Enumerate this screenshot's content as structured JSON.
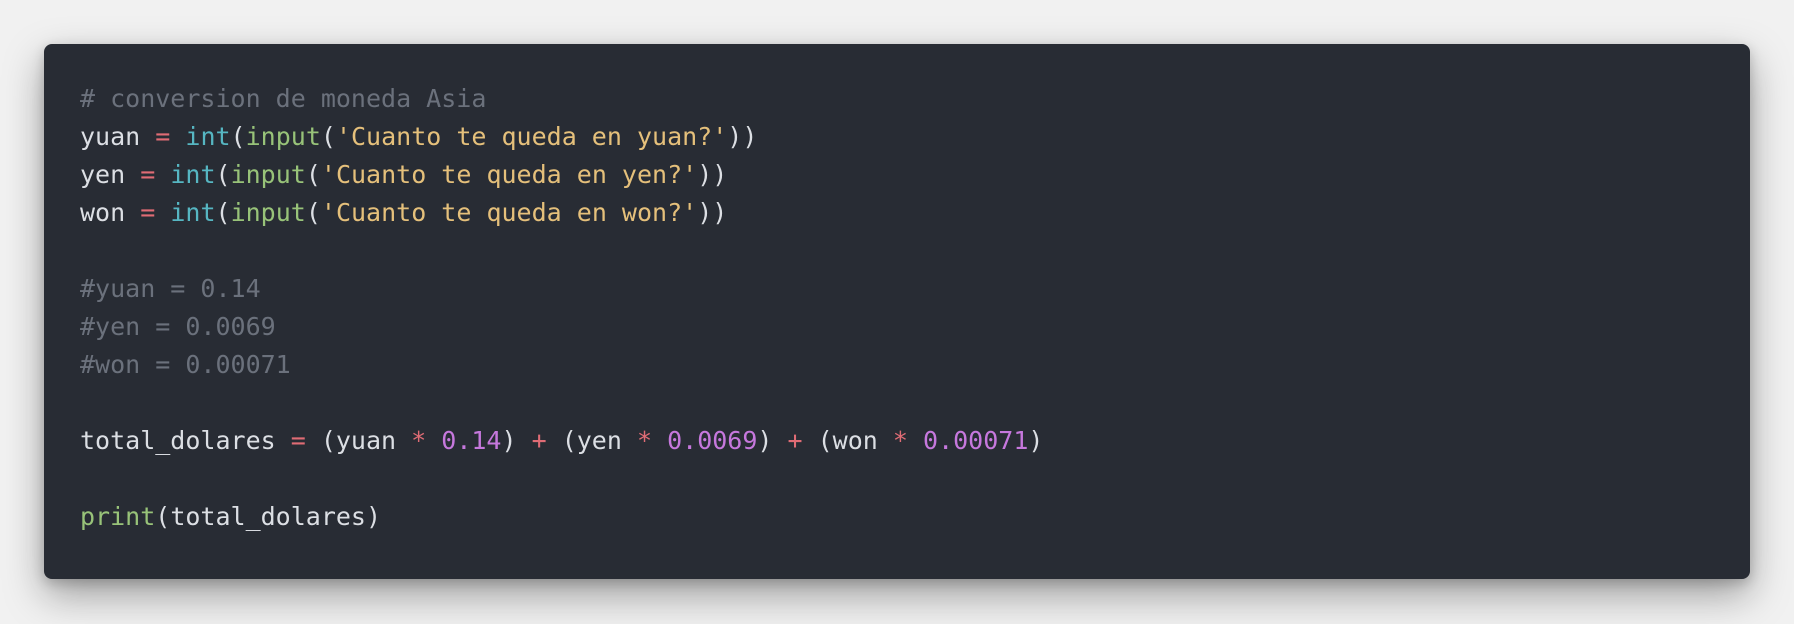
{
  "colors": {
    "page_background": "#f1f1f1",
    "code_background": "#282c34",
    "plain": "#dcdfe4",
    "comment": "#6b717c",
    "operator": "#e06c75",
    "builtin": "#56b6c2",
    "function": "#98c379",
    "string": "#e5c07b",
    "number": "#c678dd"
  },
  "code": {
    "language": "python",
    "lines": [
      [
        {
          "text": "# conversion de moneda Asia",
          "type": "comment"
        }
      ],
      [
        {
          "text": "yuan ",
          "type": "plain"
        },
        {
          "text": "=",
          "type": "op"
        },
        {
          "text": " ",
          "type": "plain"
        },
        {
          "text": "int",
          "type": "builtin"
        },
        {
          "text": "(",
          "type": "plain"
        },
        {
          "text": "input",
          "type": "func"
        },
        {
          "text": "(",
          "type": "plain"
        },
        {
          "text": "'Cuanto te queda en yuan?'",
          "type": "string"
        },
        {
          "text": "))",
          "type": "plain"
        }
      ],
      [
        {
          "text": "yen ",
          "type": "plain"
        },
        {
          "text": "=",
          "type": "op"
        },
        {
          "text": " ",
          "type": "plain"
        },
        {
          "text": "int",
          "type": "builtin"
        },
        {
          "text": "(",
          "type": "plain"
        },
        {
          "text": "input",
          "type": "func"
        },
        {
          "text": "(",
          "type": "plain"
        },
        {
          "text": "'Cuanto te queda en yen?'",
          "type": "string"
        },
        {
          "text": "))",
          "type": "plain"
        }
      ],
      [
        {
          "text": "won ",
          "type": "plain"
        },
        {
          "text": "=",
          "type": "op"
        },
        {
          "text": " ",
          "type": "plain"
        },
        {
          "text": "int",
          "type": "builtin"
        },
        {
          "text": "(",
          "type": "plain"
        },
        {
          "text": "input",
          "type": "func"
        },
        {
          "text": "(",
          "type": "plain"
        },
        {
          "text": "'Cuanto te queda en won?'",
          "type": "string"
        },
        {
          "text": "))",
          "type": "plain"
        }
      ],
      [],
      [
        {
          "text": "#yuan = 0.14",
          "type": "comment"
        }
      ],
      [
        {
          "text": "#yen = 0.0069",
          "type": "comment"
        }
      ],
      [
        {
          "text": "#won = 0.00071",
          "type": "comment"
        }
      ],
      [],
      [
        {
          "text": "total_dolares ",
          "type": "plain"
        },
        {
          "text": "=",
          "type": "op"
        },
        {
          "text": " (yuan ",
          "type": "plain"
        },
        {
          "text": "*",
          "type": "op"
        },
        {
          "text": " ",
          "type": "plain"
        },
        {
          "text": "0.14",
          "type": "number"
        },
        {
          "text": ") ",
          "type": "plain"
        },
        {
          "text": "+",
          "type": "op"
        },
        {
          "text": " (yen ",
          "type": "plain"
        },
        {
          "text": "*",
          "type": "op"
        },
        {
          "text": " ",
          "type": "plain"
        },
        {
          "text": "0.0069",
          "type": "number"
        },
        {
          "text": ") ",
          "type": "plain"
        },
        {
          "text": "+",
          "type": "op"
        },
        {
          "text": " (won ",
          "type": "plain"
        },
        {
          "text": "*",
          "type": "op"
        },
        {
          "text": " ",
          "type": "plain"
        },
        {
          "text": "0.00071",
          "type": "number"
        },
        {
          "text": ")",
          "type": "plain"
        }
      ],
      [],
      [
        {
          "text": "print",
          "type": "func"
        },
        {
          "text": "(total_dolares)",
          "type": "plain"
        }
      ]
    ]
  }
}
